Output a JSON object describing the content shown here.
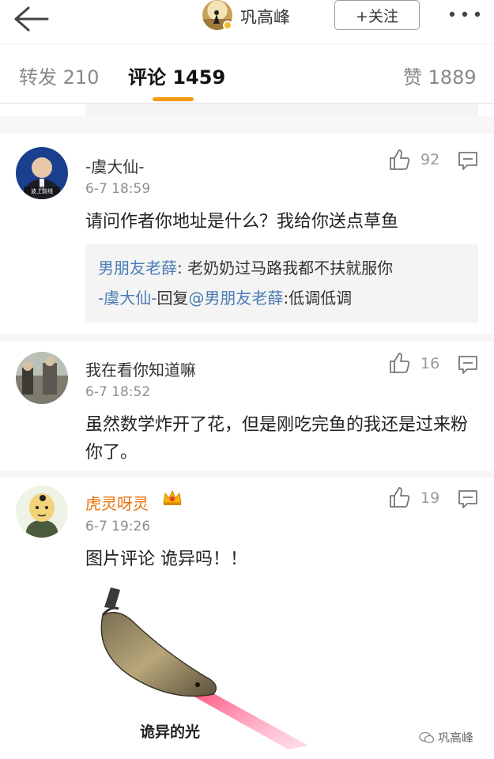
{
  "header": {
    "account_name": "巩高峰",
    "follow_label": "+关注"
  },
  "tabs": {
    "repost": "转发 210",
    "comment": "评论 1459",
    "like": "赞 1889"
  },
  "comments": [
    {
      "name": "-虞大仙-",
      "time": "6-7 18:59",
      "likes": "92",
      "text": "请问作者你地址是什么？我给你送点草鱼",
      "avatar_text": "波上前线",
      "replies": [
        {
          "author": "男朋友老薛",
          "text": ": 老奶奶过马路我都不扶就服你"
        },
        {
          "author": "-虞大仙-",
          "mid": "回复",
          "mention": "@男朋友老薛",
          "text": ":低调低调"
        }
      ]
    },
    {
      "name": "我在看你知道嘛",
      "time": "6-7 18:52",
      "likes": "16",
      "text": "虽然数学炸开了花，但是刚吃完鱼的我还是过来粉你了。"
    },
    {
      "name": "虎灵呀灵",
      "time": "6-7 19:26",
      "likes": "19",
      "text": "图片评论  诡异吗！！",
      "image_caption": "诡异的光"
    }
  ],
  "watermark": "巩高峰",
  "colors": {
    "tab_accent": "#f39c12",
    "link": "#4a7bb5",
    "vip_name": "#e8710a"
  }
}
